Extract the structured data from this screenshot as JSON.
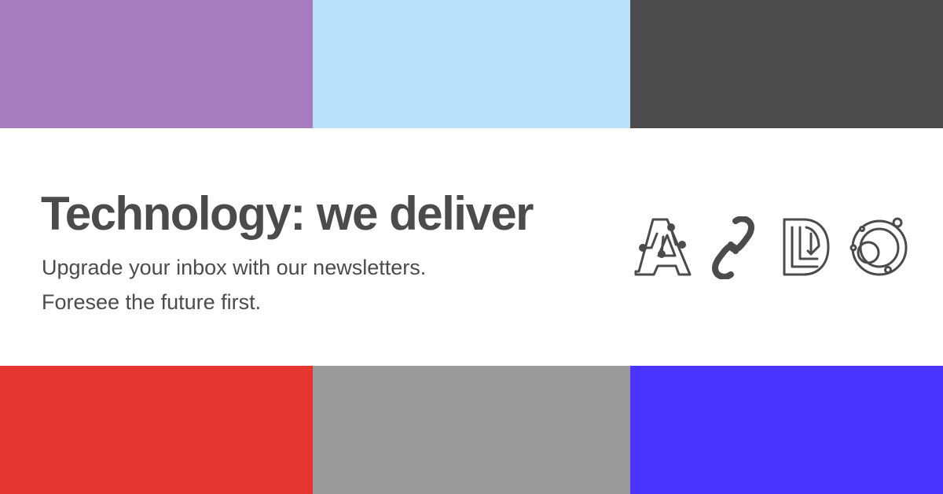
{
  "colors": {
    "top": [
      "#a77cbf",
      "#bae1fa",
      "#4b4b4b"
    ],
    "bottom": [
      "#e43530",
      "#9b9b9b",
      "#4b34ff"
    ],
    "text": "#4b4b4b",
    "background": "#ffffff"
  },
  "headline": "Technology: we deliver",
  "subheadline": {
    "line1": "Upgrade your inbox with our newsletters.",
    "line2": "Foresee the future first."
  },
  "icons": [
    "circuit-a-icon",
    "chain-link-icon",
    "box-ld-icon",
    "orbit-icon"
  ]
}
